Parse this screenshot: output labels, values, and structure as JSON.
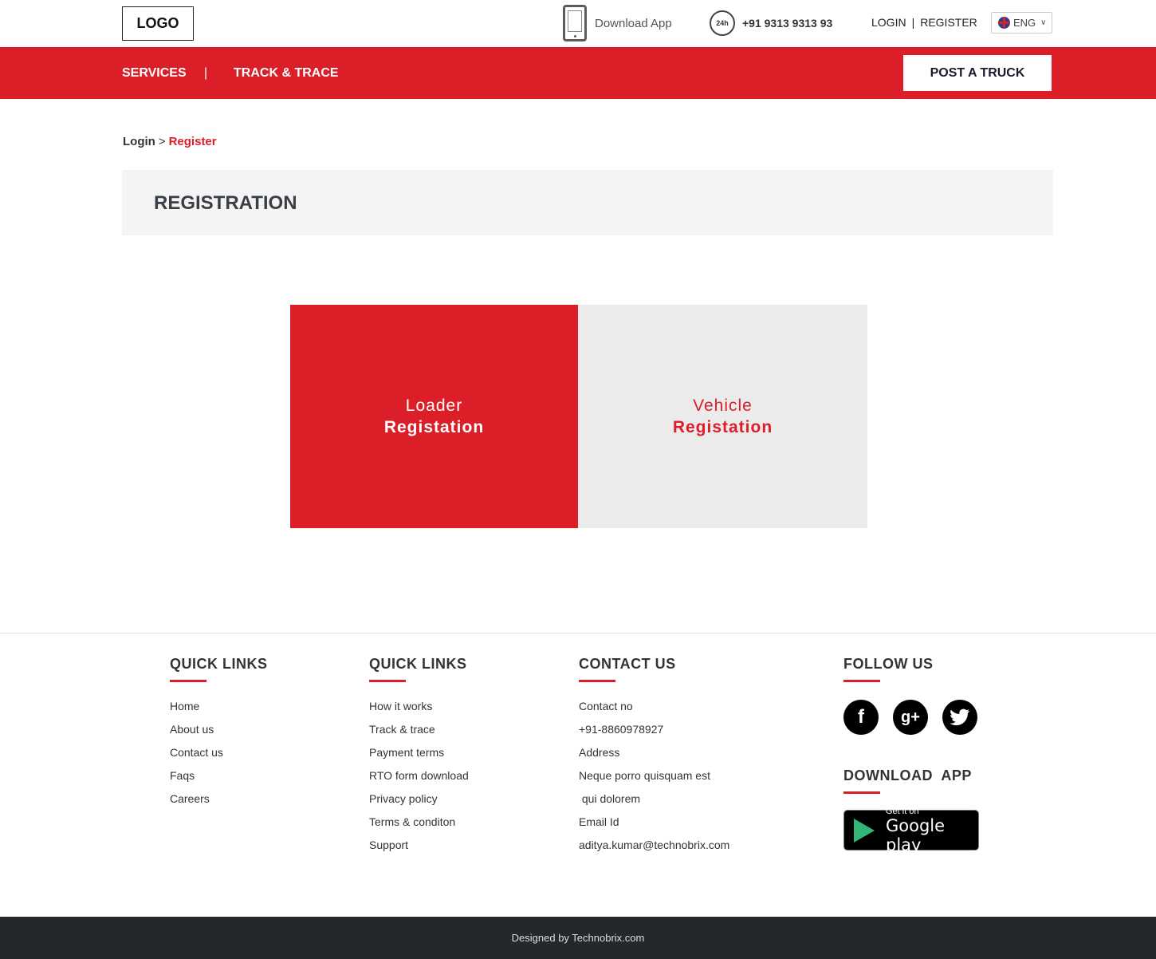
{
  "header": {
    "logo": "LOGO",
    "download_app": "Download App",
    "helpline_badge": "24h",
    "phone": "+91 9313 9313 93",
    "login": "LOGIN",
    "separator": "|",
    "register": "REGISTER",
    "language": "ENG"
  },
  "nav": {
    "services": "SERVICES",
    "separator": "|",
    "track_trace": "TRACK & TRACE",
    "post_truck": "POST A TRUCK"
  },
  "breadcrumb": {
    "parent": "Login",
    "arrow": ">",
    "current": "Register"
  },
  "page_title": "REGISTRATION",
  "cards": {
    "loader": {
      "line1": "Loader",
      "line2": "Registation"
    },
    "vehicle": {
      "line1": "Vehicle",
      "line2": "Registation"
    }
  },
  "footer": {
    "col1": {
      "title": "QUICK LINKS",
      "items": [
        "Home",
        "About us",
        "Contact us",
        "Faqs",
        "Careers"
      ]
    },
    "col2": {
      "title": "QUICK LINKS",
      "items": [
        "How it works",
        "Track & trace",
        "Payment terms",
        "RTO form download",
        "Privacy policy",
        "Terms & conditon",
        "Support"
      ]
    },
    "col3": {
      "title": "CONTACT US",
      "items": [
        "Contact no",
        "+91-8860978927",
        "Address",
        "Neque porro quisquam est",
        " qui dolorem",
        "Email Id",
        "aditya.kumar@technobrix.com"
      ]
    },
    "follow": {
      "title": "FOLLOW US",
      "facebook": "f",
      "googleplus": "g+",
      "twitter": "t"
    },
    "download": {
      "title": "DOWNLOAD  APP",
      "badge_line1": "Get it on",
      "badge_line2": "Google play"
    },
    "credit": "Designed by Technobrix.com"
  },
  "colors": {
    "brand_red": "#dc1e28",
    "footer_dark": "#23282d"
  },
  "icons": [
    "phone-icon",
    "helpline-24h-icon",
    "uk-flag-icon",
    "chevron-down-icon",
    "facebook-icon",
    "googleplus-icon",
    "twitter-icon",
    "google-play-icon"
  ]
}
